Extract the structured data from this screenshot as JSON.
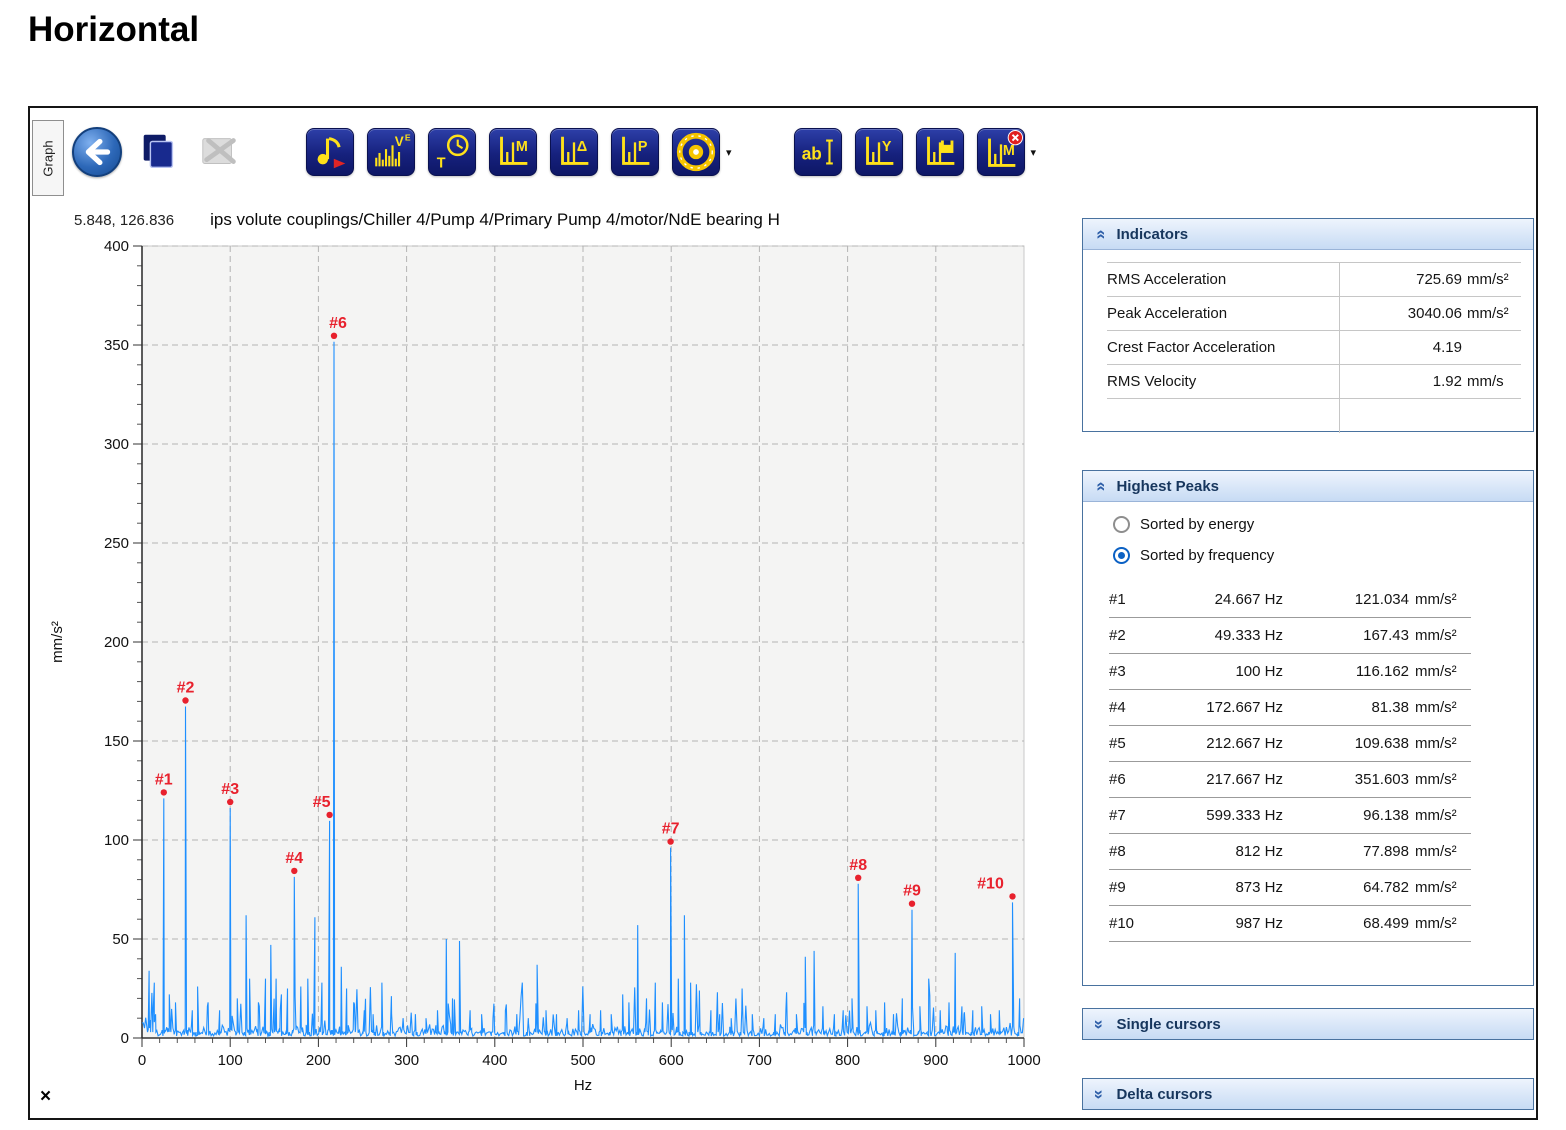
{
  "page": {
    "title": "Horizontal"
  },
  "icons": {
    "chevron_double": "»",
    "dropdown": "▾",
    "close": "×"
  },
  "toolbar": {
    "tab_label": "Graph",
    "buttons": [
      {
        "name": "back-button",
        "icon": "back-arrow-icon",
        "style": "back",
        "enabled": true
      },
      {
        "name": "copy-button",
        "icon": "copy-icon",
        "style": "copy",
        "enabled": true
      },
      {
        "name": "export-button",
        "icon": "export-disabled-icon",
        "style": "export",
        "enabled": false
      },
      {
        "name": "report-export-button",
        "icon": "music-note-export-icon",
        "style": "note",
        "gap_before": true,
        "enabled": true
      },
      {
        "name": "spectrum-velocity-button",
        "icon": "spectrum-ve-icon",
        "style": "spectrum",
        "glyph": "V",
        "sup": "E",
        "enabled": true
      },
      {
        "name": "time-waveform-button",
        "icon": "time-clock-icon",
        "style": "clock",
        "glyph": "T",
        "enabled": true
      },
      {
        "name": "markers-button",
        "icon": "chart-m-icon",
        "style": "axis",
        "glyph": "M",
        "enabled": true
      },
      {
        "name": "delta-markers-button",
        "icon": "chart-delta-icon",
        "style": "axis",
        "glyph": "Δ",
        "enabled": true
      },
      {
        "name": "peak-markers-button",
        "icon": "chart-p-icon",
        "style": "axis",
        "glyph": "P",
        "enabled": true
      },
      {
        "name": "bearing-frequencies-button",
        "icon": "bearing-icon",
        "style": "bearing",
        "dropdown": true,
        "enabled": true
      },
      {
        "name": "annotation-button",
        "icon": "text-cursor-icon",
        "style": "text",
        "glyph": "ab",
        "gap_before": true,
        "enabled": true
      },
      {
        "name": "y-scale-button",
        "icon": "chart-y-icon",
        "style": "axis",
        "glyph": "Y",
        "enabled": true
      },
      {
        "name": "save-chart-button",
        "icon": "chart-save-icon",
        "style": "axisdisk",
        "enabled": true
      },
      {
        "name": "remove-markers-button",
        "icon": "chart-m-remove-icon",
        "style": "axisbadge",
        "glyph": "M",
        "dropdown": true,
        "enabled": true
      }
    ]
  },
  "chart": {
    "cursor_readout": "5.848, 126.836",
    "title": "ips volute couplings/Chiller 4/Pump 4/Primary Pump 4/motor/NdE bearing H"
  },
  "chart_data": {
    "type": "line",
    "title": "ips volute couplings/Chiller 4/Pump 4/Primary Pump 4/motor/NdE bearing H",
    "xlabel": "Hz",
    "ylabel": "mm/s²",
    "xlim": [
      0,
      1000
    ],
    "ylim": [
      0,
      400
    ],
    "x_major_ticks": [
      0,
      100,
      200,
      300,
      400,
      500,
      600,
      700,
      800,
      900,
      1000
    ],
    "y_major_ticks": [
      0,
      50,
      100,
      150,
      200,
      250,
      300,
      350,
      400
    ],
    "x_minor_step": 20,
    "y_minor_step": 10,
    "grid": "dashed",
    "line_color": "#1e8fff",
    "peak_label_color": "#e8212d",
    "labeled_peaks": [
      {
        "label": "#1",
        "hz": 24.667,
        "amp": 121.034
      },
      {
        "label": "#2",
        "hz": 49.333,
        "amp": 167.43
      },
      {
        "label": "#3",
        "hz": 100,
        "amp": 116.162
      },
      {
        "label": "#4",
        "hz": 172.667,
        "amp": 81.38
      },
      {
        "label": "#5",
        "hz": 212.667,
        "amp": 109.638,
        "label_dx": -8
      },
      {
        "label": "#6",
        "hz": 217.667,
        "amp": 351.603,
        "label_dx": 4
      },
      {
        "label": "#7",
        "hz": 599.333,
        "amp": 96.138
      },
      {
        "label": "#8",
        "hz": 812,
        "amp": 77.898
      },
      {
        "label": "#9",
        "hz": 873,
        "amp": 64.782
      },
      {
        "label": "#10",
        "hz": 987,
        "amp": 68.499,
        "label_dx": -22
      }
    ],
    "unlabeled_peaks_estimated": [
      [
        8,
        34
      ],
      [
        14,
        28
      ],
      [
        31,
        22
      ],
      [
        38,
        18
      ],
      [
        57,
        14
      ],
      [
        63,
        26
      ],
      [
        75,
        18
      ],
      [
        88,
        14
      ],
      [
        108,
        20
      ],
      [
        118,
        62
      ],
      [
        122,
        30
      ],
      [
        132,
        18
      ],
      [
        140,
        30
      ],
      [
        146,
        47
      ],
      [
        152,
        30
      ],
      [
        158,
        22
      ],
      [
        165,
        25
      ],
      [
        180,
        26
      ],
      [
        188,
        30
      ],
      [
        196,
        61
      ],
      [
        204,
        28
      ],
      [
        226,
        36
      ],
      [
        232,
        25
      ],
      [
        240,
        18
      ],
      [
        252,
        14
      ],
      [
        262,
        12
      ],
      [
        272,
        28
      ],
      [
        283,
        12
      ],
      [
        296,
        10
      ],
      [
        310,
        12
      ],
      [
        322,
        10
      ],
      [
        335,
        14
      ],
      [
        345,
        50
      ],
      [
        352,
        20
      ],
      [
        360,
        49
      ],
      [
        372,
        14
      ],
      [
        385,
        12
      ],
      [
        398,
        10
      ],
      [
        412,
        14
      ],
      [
        425,
        12
      ],
      [
        438,
        10
      ],
      [
        448,
        37
      ],
      [
        458,
        14
      ],
      [
        470,
        12
      ],
      [
        482,
        10
      ],
      [
        495,
        14
      ],
      [
        508,
        12
      ],
      [
        520,
        14
      ],
      [
        532,
        12
      ],
      [
        545,
        22
      ],
      [
        552,
        18
      ],
      [
        562,
        57
      ],
      [
        572,
        20
      ],
      [
        582,
        28
      ],
      [
        590,
        18
      ],
      [
        608,
        30
      ],
      [
        615,
        62
      ],
      [
        622,
        28
      ],
      [
        632,
        24
      ],
      [
        645,
        14
      ],
      [
        655,
        12
      ],
      [
        668,
        10
      ],
      [
        680,
        14
      ],
      [
        692,
        12
      ],
      [
        705,
        10
      ],
      [
        718,
        12
      ],
      [
        730,
        14
      ],
      [
        742,
        12
      ],
      [
        752,
        41
      ],
      [
        762,
        44
      ],
      [
        772,
        16
      ],
      [
        785,
        12
      ],
      [
        795,
        14
      ],
      [
        805,
        20
      ],
      [
        822,
        16
      ],
      [
        832,
        14
      ],
      [
        842,
        18
      ],
      [
        852,
        12
      ],
      [
        862,
        20
      ],
      [
        882,
        16
      ],
      [
        892,
        30
      ],
      [
        905,
        14
      ],
      [
        915,
        18
      ],
      [
        922,
        43
      ],
      [
        932,
        12
      ],
      [
        942,
        14
      ],
      [
        952,
        16
      ],
      [
        962,
        12
      ],
      [
        972,
        14
      ],
      [
        995,
        20
      ]
    ],
    "legend": null
  },
  "indicators": {
    "header": "Indicators",
    "rows": [
      {
        "label": "RMS Acceleration",
        "value": "725.69",
        "unit": "mm/s²"
      },
      {
        "label": "Peak Acceleration",
        "value": "3040.06",
        "unit": "mm/s²"
      },
      {
        "label": "Crest Factor Acceleration",
        "value": "4.19",
        "unit": ""
      },
      {
        "label": "RMS Velocity",
        "value": "1.92",
        "unit": "mm/s"
      }
    ]
  },
  "highest_peaks": {
    "header": "Highest Peaks",
    "options": [
      {
        "label": "Sorted by energy",
        "selected": false
      },
      {
        "label": "Sorted by frequency",
        "selected": true
      }
    ],
    "rows": [
      {
        "rank": "#1",
        "freq": "24.667 Hz",
        "amp": "121.034",
        "unit": "mm/s²"
      },
      {
        "rank": "#2",
        "freq": "49.333 Hz",
        "amp": "167.43",
        "unit": "mm/s²"
      },
      {
        "rank": "#3",
        "freq": "100 Hz",
        "amp": "116.162",
        "unit": "mm/s²"
      },
      {
        "rank": "#4",
        "freq": "172.667 Hz",
        "amp": "81.38",
        "unit": "mm/s²"
      },
      {
        "rank": "#5",
        "freq": "212.667 Hz",
        "amp": "109.638",
        "unit": "mm/s²"
      },
      {
        "rank": "#6",
        "freq": "217.667 Hz",
        "amp": "351.603",
        "unit": "mm/s²"
      },
      {
        "rank": "#7",
        "freq": "599.333 Hz",
        "amp": "96.138",
        "unit": "mm/s²"
      },
      {
        "rank": "#8",
        "freq": "812 Hz",
        "amp": "77.898",
        "unit": "mm/s²"
      },
      {
        "rank": "#9",
        "freq": "873 Hz",
        "amp": "64.782",
        "unit": "mm/s²"
      },
      {
        "rank": "#10",
        "freq": "987 Hz",
        "amp": "68.499",
        "unit": "mm/s²"
      }
    ]
  },
  "single_cursors": {
    "header": "Single cursors"
  },
  "delta_cursors": {
    "header": "Delta cursors"
  }
}
